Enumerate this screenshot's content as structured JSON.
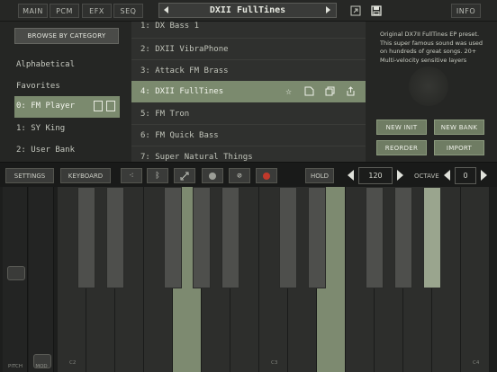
{
  "top_tabs": [
    "MAIN",
    "PCM",
    "EFX",
    "SEQ"
  ],
  "preset_title": "DXII FullTines",
  "info_label": "INFO",
  "browse_label": "BROWSE BY CATEGORY",
  "left_items": [
    "Alphabetical",
    "Favorites",
    "0: FM Player",
    "1: SY King",
    "2: User Bank"
  ],
  "presets": [
    "1: DX Bass 1",
    "2: DXII VibraPhone",
    "3: Attack FM Brass",
    "4: DXII FullTines",
    "5: FM Tron",
    "6: FM Quick Bass",
    "7: Super Natural Things"
  ],
  "description": "Original DX7II FullTines EP preset. This super famous sound was used on hundreds of great songs. 20+ Multi-velocity sensitive layers",
  "right_buttons": {
    "new_init": "NEW INIT",
    "new_bank": "NEW BANK",
    "reorder": "REORDER",
    "import": "IMPORT"
  },
  "controls": {
    "settings": "SETTINGS",
    "keyboard": "KEYBOARD",
    "hold": "HOLD",
    "tempo": "120",
    "octave_label": "OCTAVE",
    "octave": "0"
  },
  "wheels": {
    "pitch": "PITCH",
    "mod": "MOD"
  },
  "octave_labels": [
    "C2",
    "C3",
    "C4"
  ],
  "colors": {
    "accent": "#7b8a6e",
    "record": "#c0392b"
  },
  "icons": [
    "shuffle-icon",
    "bluetooth-icon",
    "link-icon",
    "circle-icon",
    "no-icon",
    "record-icon",
    "star-icon",
    "edit-icon",
    "copy-icon",
    "share-icon",
    "save-icon",
    "export-icon"
  ]
}
